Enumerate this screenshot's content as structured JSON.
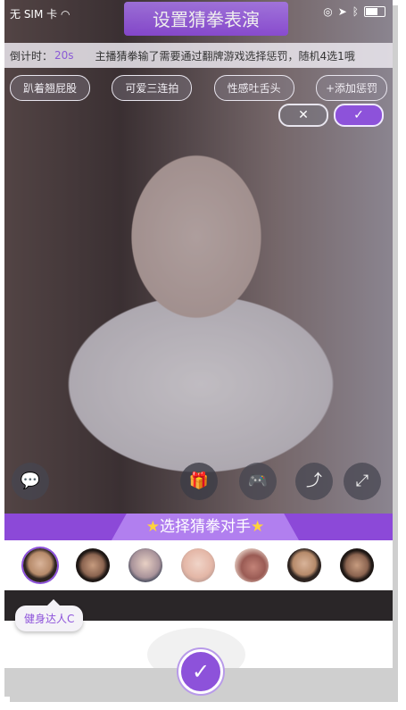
{
  "status": {
    "carrier": "无 SIM 卡",
    "wifi_icon": "wifi-icon"
  },
  "header": {
    "title": "设置猜拳表演"
  },
  "timer": {
    "label": "倒计时：",
    "value": "20s",
    "description": "主播猜拳输了需要通过翻牌游戏选择惩罚，随机4选1哦"
  },
  "punishments": [
    "趴着翘屁股",
    "可爱三连拍",
    "性感吐舌头",
    "+添加惩罚"
  ],
  "actions": {
    "cancel": "✕",
    "confirm": "✓"
  },
  "tools": [
    {
      "icon": "chat-icon",
      "glyph": "💬"
    },
    {
      "icon": "gift-icon",
      "glyph": "🎁"
    },
    {
      "icon": "gamepad-icon",
      "glyph": "🎮"
    },
    {
      "icon": "share-icon",
      "glyph": "⤴"
    },
    {
      "icon": "fullscreen-icon",
      "glyph": "⤢"
    }
  ],
  "panel": {
    "title": "选择猜拳对手",
    "star": "★"
  },
  "opponent_tooltip": "健身达人C",
  "confirm_glyph": "✓",
  "colors": {
    "accent": "#8d52da",
    "star": "#ffd33b"
  }
}
